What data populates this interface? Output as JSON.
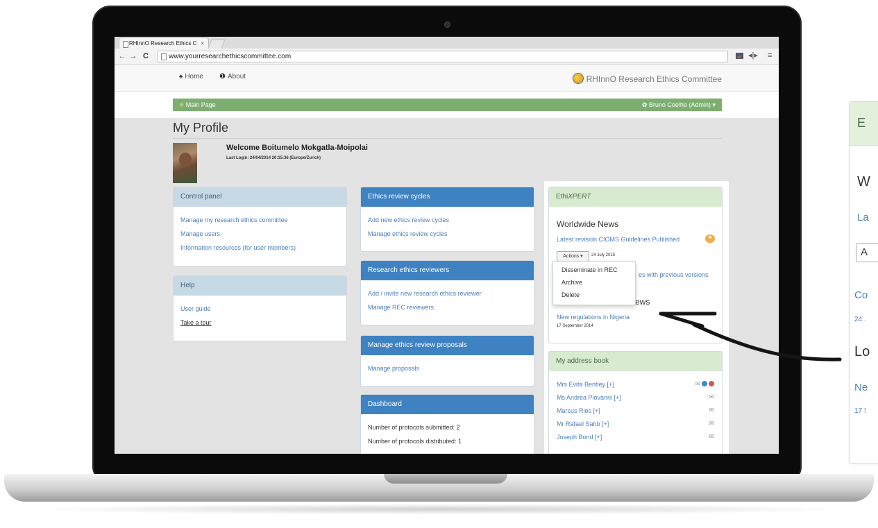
{
  "browser": {
    "tab_title": "RHInnO Research Ethics C",
    "tab_close": "×",
    "url": "www.yourresearchethicscommittee.com"
  },
  "nav": {
    "home": "Home",
    "about": "About",
    "brand": "RHInnO Research Ethics Committee"
  },
  "bar": {
    "main_page": "Main Page",
    "user": "Bruno Coelho (Admin)"
  },
  "profile": {
    "title": "My Profile",
    "welcome": "Welcome Boitumelo Mokgatla-Moipolai",
    "last_login": "Last Login: 24/04/2014 20:15:36 (Europe/Zurich)"
  },
  "control_panel": {
    "title": "Control panel",
    "links": [
      "Manage my research ethics committee",
      "Manage users",
      "Information resources (for user members)"
    ]
  },
  "help": {
    "title": "Help",
    "links": [
      "User guide",
      "Take a tour"
    ]
  },
  "review_cycles": {
    "title": "Ethics review cycles",
    "links": [
      "Add new ethics review cycles",
      "Manage ethics review cycles"
    ]
  },
  "reviewers": {
    "title": "Research ethics reviewers",
    "links": [
      "Add / invite new research ethics reviewer",
      "Manage REC reviewers"
    ]
  },
  "proposals": {
    "title": "Manage ethics review proposals",
    "links": [
      "Manage proposals"
    ]
  },
  "dashboard": {
    "title": "Dashboard",
    "lines": [
      "Number of protocols submitted: 2",
      "Number of protocols distributed: 1"
    ]
  },
  "ethixpert": {
    "title_prefix": "Ethi",
    "title_italic": "XPERT",
    "worldwide_title": "Worldwide News",
    "news1": "Latest revision CIOMS Guidelines Published",
    "actions_label": "Actions ▾",
    "news1_date": "24 July 2015",
    "news2_left": "C",
    "news2_right": "es with previous versions",
    "news2_date": "2",
    "local_left": "L",
    "local_right": "ews",
    "news3": "New regulations in Nigeria",
    "news3_date": "17 September 2014",
    "dropdown": [
      "Disseminate in REC",
      "Archive",
      "Delete"
    ]
  },
  "address_book": {
    "title": "My address book",
    "contacts": [
      "Mrs Evita Bentley [+]",
      "Ms Andrea Piovanni [+]",
      "Marcus Rios [+]",
      "Mr Rafael Sahb [+]",
      "Joseph Bond [+]"
    ]
  },
  "zoom": {
    "head": "E",
    "w": "W",
    "la": "La",
    "a": "A",
    "co": "Co",
    "d": "24 .",
    "lo": "Lo",
    "ne": "Ne",
    "d2": "17 !"
  },
  "colors": {
    "green_bar": "#7cae6f",
    "panel_blue": "#3e82c2",
    "link_blue": "#4a7fb8",
    "flag_orange": "#f0ad4e"
  }
}
